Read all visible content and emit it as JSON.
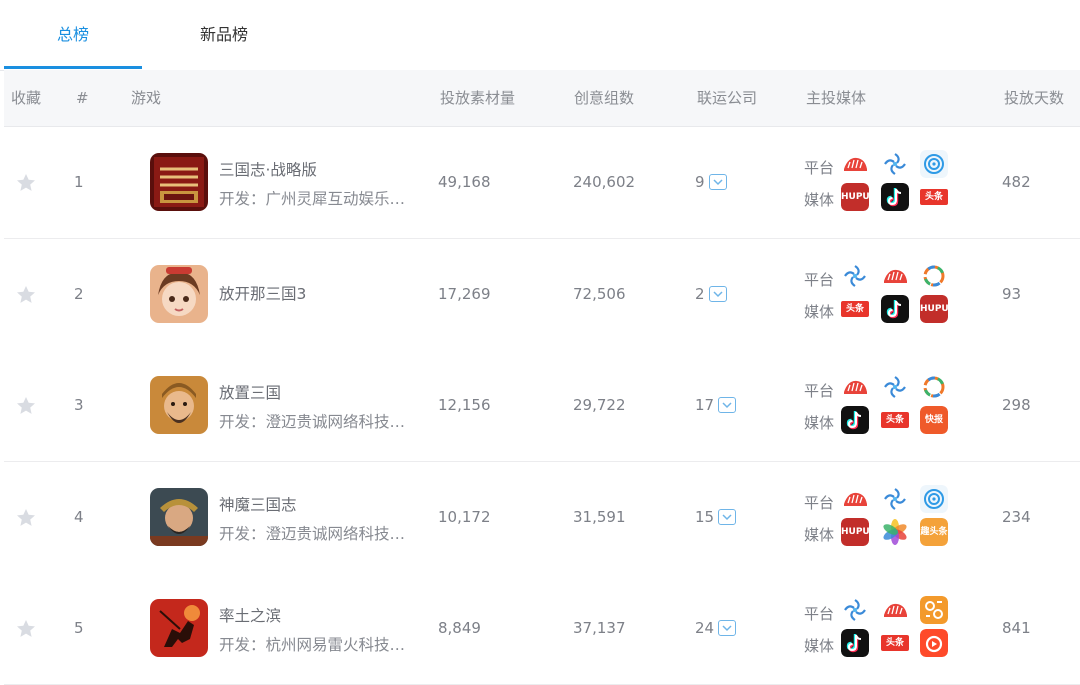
{
  "tabs": [
    {
      "label": "总榜",
      "active": true
    },
    {
      "label": "新品榜",
      "active": false
    }
  ],
  "columns": {
    "fav": "收藏",
    "rank": "#",
    "game": "游戏",
    "materials": "投放素材量",
    "creatives": "创意组数",
    "companies": "联运公司",
    "media": "主投媒体",
    "days": "投放天数"
  },
  "media_labels": {
    "platform": "平台",
    "media": "媒体"
  },
  "colors": {
    "accent": "#1a8fe0",
    "star": "#d9dce2"
  },
  "rows": [
    {
      "rank": "1",
      "name": "三国志·战略版",
      "developer": "开发：广州灵犀互动娱乐有限公司",
      "materials": "49,168",
      "creatives": "240,602",
      "companies": "9",
      "days": "482",
      "platform_icons": [
        "pangolin-icon",
        "guangdiantong-icon",
        "baidu-icon"
      ],
      "media_icons": [
        "hupu-icon",
        "douyin-icon",
        "toutiao-icon"
      ],
      "icon_text": {
        "hupu-icon": "HUPU",
        "toutiao-icon": "头条"
      }
    },
    {
      "rank": "2",
      "name": "放开那三国3",
      "developer": "",
      "materials": "17,269",
      "creatives": "72,506",
      "companies": "2",
      "days": "93",
      "platform_icons": [
        "guangdiantong-icon",
        "pangolin-icon",
        "wifi-icon"
      ],
      "media_icons": [
        "toutiao-icon",
        "douyin-icon",
        "hupu-icon"
      ],
      "icon_text": {
        "hupu-icon": "HUPU",
        "toutiao-icon": "头条"
      }
    },
    {
      "rank": "3",
      "name": "放置三国",
      "developer": "开发：澄迈贵诚网络科技有限公司",
      "materials": "12,156",
      "creatives": "29,722",
      "companies": "17",
      "days": "298",
      "platform_icons": [
        "pangolin-icon",
        "guangdiantong-icon",
        "wifi-icon"
      ],
      "media_icons": [
        "douyin-icon",
        "toutiao-icon",
        "kuaibao-icon"
      ],
      "icon_text": {
        "toutiao-icon": "头条",
        "kuaibao-icon": "快报"
      }
    },
    {
      "rank": "4",
      "name": "神魔三国志",
      "developer": "开发：澄迈贵诚网络科技有限公司",
      "materials": "10,172",
      "creatives": "31,591",
      "companies": "15",
      "days": "234",
      "platform_icons": [
        "pangolin-icon",
        "guangdiantong-icon",
        "baidu-icon"
      ],
      "media_icons": [
        "hupu-icon",
        "photos-icon",
        "quntoutiao-icon"
      ],
      "icon_text": {
        "hupu-icon": "HUPU",
        "quntoutiao-icon": "趣头条"
      }
    },
    {
      "rank": "5",
      "name": "率土之滨",
      "developer": "开发：杭州网易雷火科技有限公司",
      "materials": "8,849",
      "creatives": "37,137",
      "companies": "24",
      "days": "841",
      "platform_icons": [
        "guangdiantong-icon",
        "pangolin-icon",
        "weishi-icon"
      ],
      "media_icons": [
        "douyin-icon",
        "toutiao-icon",
        "kuaishou-icon"
      ],
      "icon_text": {
        "toutiao-icon": "头条"
      }
    }
  ]
}
